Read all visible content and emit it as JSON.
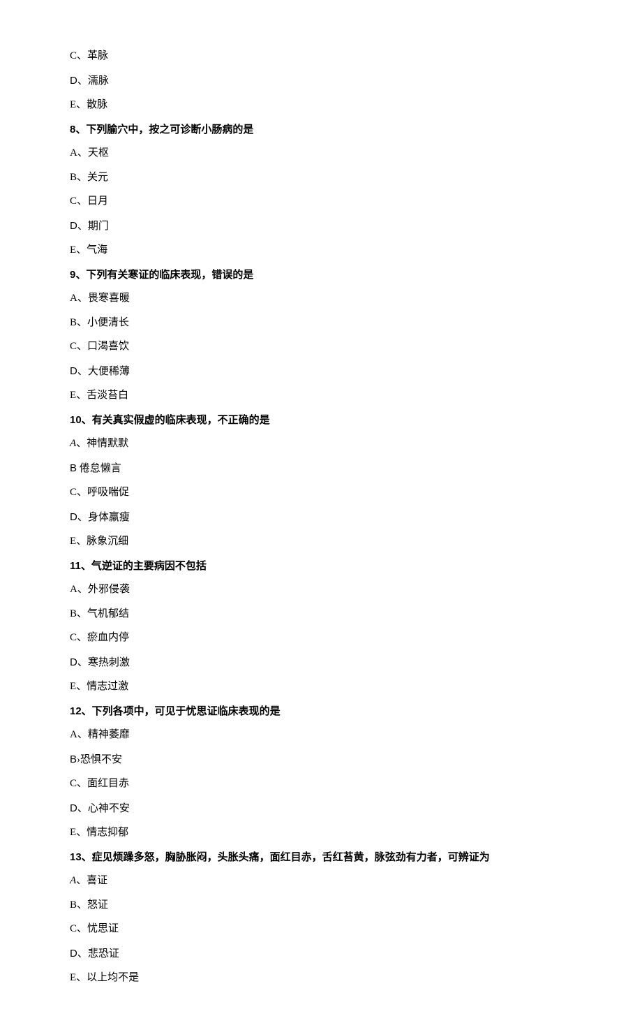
{
  "lines": [
    {
      "type": "option",
      "text": "C、革脉"
    },
    {
      "type": "option",
      "text": "D、濡脉",
      "letterSans": true
    },
    {
      "type": "option",
      "text": "E、散脉"
    },
    {
      "type": "stem",
      "text": "8、下列腧穴中，按之可诊断小肠病的是"
    },
    {
      "type": "option",
      "text": "A、天枢"
    },
    {
      "type": "option",
      "text": "B、关元"
    },
    {
      "type": "option",
      "text": "C、日月"
    },
    {
      "type": "option",
      "text": "D、期门",
      "letterSans": true
    },
    {
      "type": "option",
      "text": "E、气海"
    },
    {
      "type": "stem",
      "text": "9、下列有关寒证的临床表现，错误的是"
    },
    {
      "type": "option",
      "text": "A、畏寒喜暖"
    },
    {
      "type": "option",
      "text": "B、小便清长"
    },
    {
      "type": "option",
      "text": "C、口渴喜饮"
    },
    {
      "type": "option",
      "text": "D、大便稀薄",
      "letterSans": true
    },
    {
      "type": "option",
      "text": "E、舌淡苔白"
    },
    {
      "type": "stem",
      "text": "10、有关真实假虚的临床表现，不正确的是"
    },
    {
      "type": "option",
      "text": "A、神情默默",
      "italicA": true
    },
    {
      "type": "option",
      "text": "B 倦怠懒言",
      "letterSans": true
    },
    {
      "type": "option",
      "text": "C、呼吸喘促"
    },
    {
      "type": "option",
      "text": "D、身体羸瘦",
      "letterSans": true
    },
    {
      "type": "option",
      "text": "E、脉象沉细"
    },
    {
      "type": "stem",
      "text": "11、气逆证的主要病因不包括"
    },
    {
      "type": "option",
      "text": "A、外邪侵袭"
    },
    {
      "type": "option",
      "text": "B、气机郁结"
    },
    {
      "type": "option",
      "text": "C、瘀血内停"
    },
    {
      "type": "option",
      "text": "D、寒热刺激",
      "letterSans": true
    },
    {
      "type": "option",
      "text": "E、情志过激"
    },
    {
      "type": "stem",
      "text": "12、下列各项中，可见于忧思证临床表现的是"
    },
    {
      "type": "option",
      "text": "A、精神萎靡"
    },
    {
      "type": "option",
      "text": "B›恐惧不安",
      "letterSans": true
    },
    {
      "type": "option",
      "text": "C、面红目赤"
    },
    {
      "type": "option",
      "text": "D、心神不安",
      "letterSans": true
    },
    {
      "type": "option",
      "text": "E、情志抑郁"
    },
    {
      "type": "stem",
      "text": "13、症见烦躁多怒，胸胁胀闷，头胀头痛，面红目赤，舌红苔黄，脉弦劲有力者，可辨证为"
    },
    {
      "type": "option",
      "text": "A、喜证",
      "italicA": true
    },
    {
      "type": "option",
      "text": "B、怒证"
    },
    {
      "type": "option",
      "text": "C、忧思证"
    },
    {
      "type": "option",
      "text": "D、悲恐证",
      "letterSans": true
    },
    {
      "type": "option",
      "text": "E、以上均不是"
    }
  ]
}
